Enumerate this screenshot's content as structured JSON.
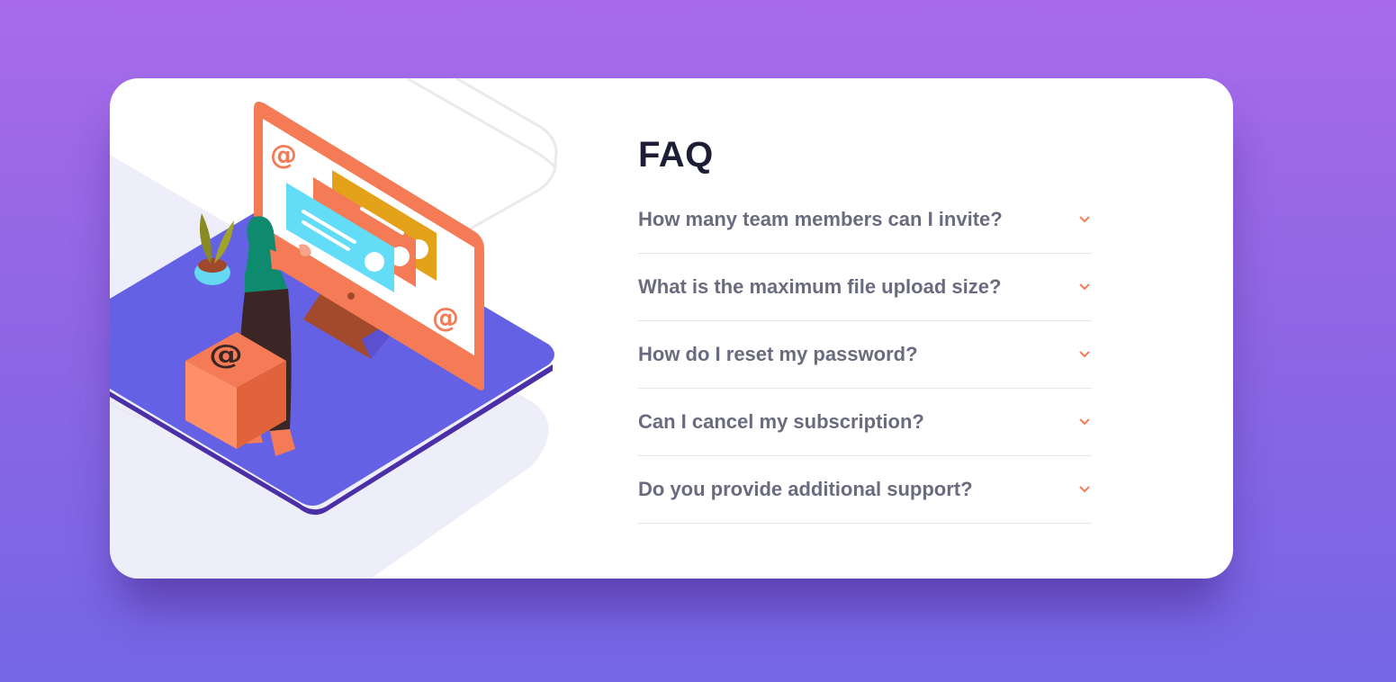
{
  "faq": {
    "title": "FAQ",
    "questions": [
      {
        "text": "How many team members can I invite?",
        "icon": "chevron-down-icon"
      },
      {
        "text": "What is the maximum file upload size?",
        "icon": "chevron-down-icon"
      },
      {
        "text": "How do I reset my password?",
        "icon": "chevron-down-icon"
      },
      {
        "text": "Can I cancel my subscription?",
        "icon": "chevron-down-icon"
      },
      {
        "text": "Do you provide additional support?",
        "icon": "chevron-down-icon"
      }
    ]
  },
  "illustration": {
    "name": "woman-with-online-monitor-illustration",
    "symbols": [
      "@",
      "@",
      "@"
    ]
  },
  "colors": {
    "background_top": "#a86aea",
    "background_bottom": "#7466e5",
    "card": "#ffffff",
    "title": "#1d1e35",
    "question_text": "#6a6b7f",
    "chevron": "#f47b56",
    "divider": "#e5e5ea",
    "monitor": "#f47b56",
    "platform": "#6461e4"
  }
}
